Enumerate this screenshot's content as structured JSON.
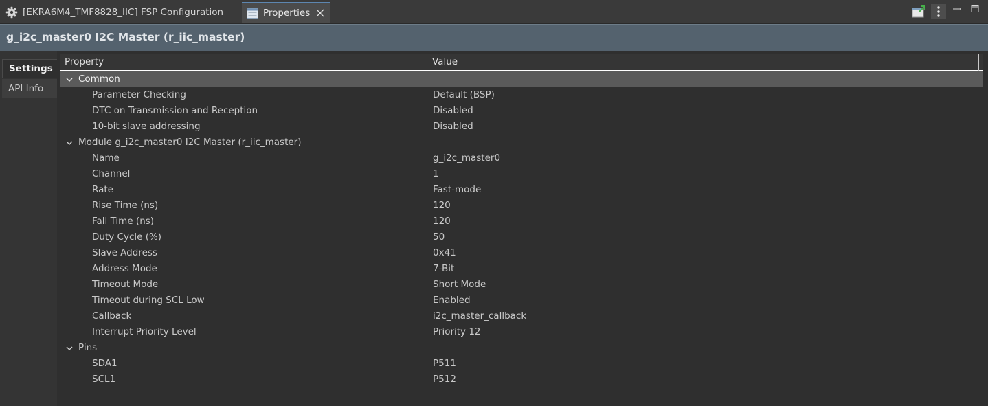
{
  "tabs": {
    "config_tab_label": "[EKRA6M4_TMF8828_IIC] FSP Configuration",
    "properties_tab_label": "Properties"
  },
  "icons": {
    "config": "gear-icon",
    "properties": "properties-icon",
    "close": "close-icon",
    "new_view": "new-view-icon",
    "menu": "view-menu-icon",
    "minimize": "minimize-icon",
    "maximize": "maximize-icon",
    "chevron": "chevron-down-icon"
  },
  "header": {
    "title": "g_i2c_master0 I2C Master (r_iic_master)"
  },
  "sidetabs": {
    "settings": "Settings",
    "api_info": "API Info"
  },
  "table": {
    "col_property": "Property",
    "col_value": "Value",
    "groups": [
      {
        "label": "Common",
        "rows": [
          {
            "property": "Parameter Checking",
            "value": "Default (BSP)"
          },
          {
            "property": "DTC on Transmission and Reception",
            "value": "Disabled"
          },
          {
            "property": "10-bit slave addressing",
            "value": "Disabled"
          }
        ]
      },
      {
        "label": "Module g_i2c_master0 I2C Master (r_iic_master)",
        "rows": [
          {
            "property": "Name",
            "value": "g_i2c_master0"
          },
          {
            "property": "Channel",
            "value": "1"
          },
          {
            "property": "Rate",
            "value": "Fast-mode"
          },
          {
            "property": "Rise Time (ns)",
            "value": "120"
          },
          {
            "property": "Fall Time (ns)",
            "value": "120"
          },
          {
            "property": "Duty Cycle (%)",
            "value": "50"
          },
          {
            "property": "Slave Address",
            "value": "0x41"
          },
          {
            "property": "Address Mode",
            "value": "7-Bit"
          },
          {
            "property": "Timeout Mode",
            "value": "Short Mode"
          },
          {
            "property": "Timeout during SCL Low",
            "value": "Enabled"
          },
          {
            "property": "Callback",
            "value": "i2c_master_callback"
          },
          {
            "property": "Interrupt Priority Level",
            "value": "Priority 12"
          }
        ]
      },
      {
        "label": "Pins",
        "rows": [
          {
            "property": "SDA1",
            "value": "P511"
          },
          {
            "property": "SCL1",
            "value": "P512"
          }
        ]
      }
    ]
  },
  "colors": {
    "accent": "#5d86b0",
    "title_bar": "#54626e",
    "selected_row": "#5a5a5a"
  }
}
